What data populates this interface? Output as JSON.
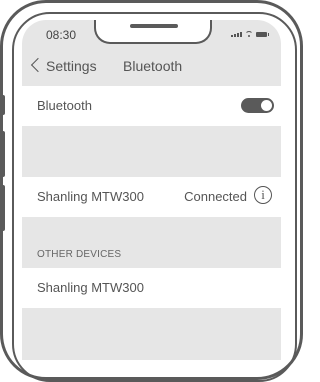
{
  "status_bar": {
    "time": "08:30",
    "icons": [
      "signal-icon",
      "wifi-icon",
      "battery-icon"
    ]
  },
  "nav": {
    "back_label": "Settings",
    "title": "Bluetooth"
  },
  "bluetooth_row": {
    "label": "Bluetooth",
    "toggle_on": true
  },
  "my_devices": [
    {
      "name": "Shanling MTW300",
      "status": "Connected",
      "info_symbol": "i"
    }
  ],
  "other_devices": {
    "header": "OTHER DEVICES",
    "items": [
      {
        "name": "Shanling MTW300"
      }
    ]
  }
}
